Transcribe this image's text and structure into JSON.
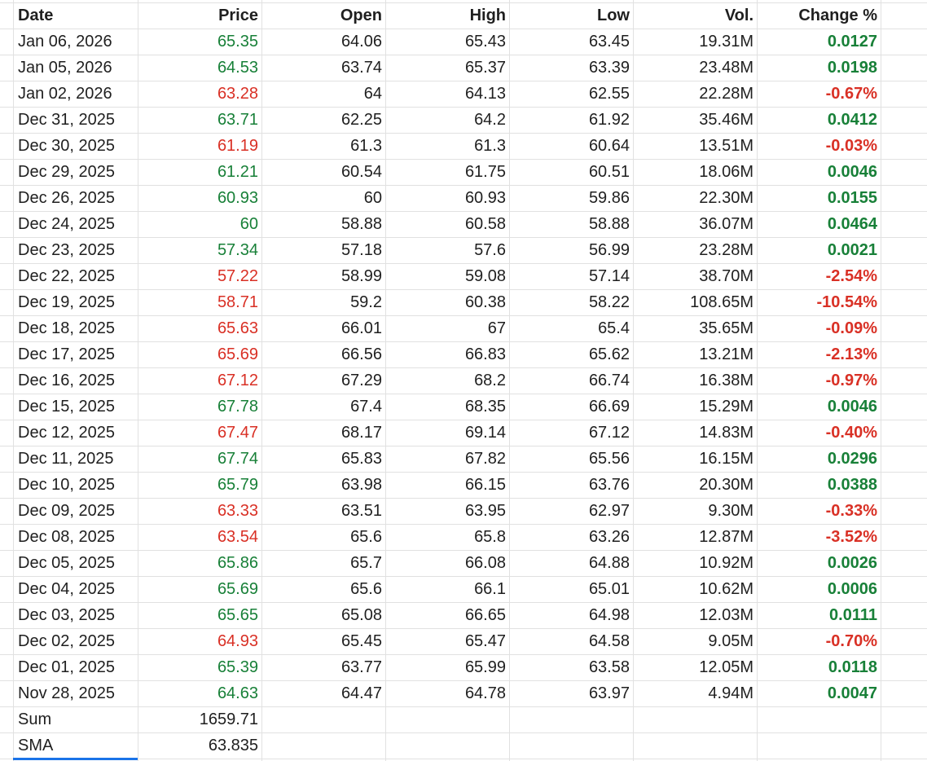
{
  "colors": {
    "up": "#188038",
    "down": "#d93025",
    "grid": "#e1e1e1",
    "text": "#1f1f1f",
    "selection": "#1a73e8"
  },
  "header": {
    "date": "Date",
    "price": "Price",
    "open": "Open",
    "high": "High",
    "low": "Low",
    "vol": "Vol.",
    "change": "Change %"
  },
  "rows": [
    {
      "date": "Jan 06, 2026",
      "price": "65.35",
      "open": "64.06",
      "high": "65.43",
      "low": "63.45",
      "vol": "19.31M",
      "change": "0.0127",
      "dir": "up"
    },
    {
      "date": "Jan 05, 2026",
      "price": "64.53",
      "open": "63.74",
      "high": "65.37",
      "low": "63.39",
      "vol": "23.48M",
      "change": "0.0198",
      "dir": "up"
    },
    {
      "date": "Jan 02, 2026",
      "price": "63.28",
      "open": "64",
      "high": "64.13",
      "low": "62.55",
      "vol": "22.28M",
      "change": "-0.67%",
      "dir": "down"
    },
    {
      "date": "Dec 31, 2025",
      "price": "63.71",
      "open": "62.25",
      "high": "64.2",
      "low": "61.92",
      "vol": "35.46M",
      "change": "0.0412",
      "dir": "up"
    },
    {
      "date": "Dec 30, 2025",
      "price": "61.19",
      "open": "61.3",
      "high": "61.3",
      "low": "60.64",
      "vol": "13.51M",
      "change": "-0.03%",
      "dir": "down"
    },
    {
      "date": "Dec 29, 2025",
      "price": "61.21",
      "open": "60.54",
      "high": "61.75",
      "low": "60.51",
      "vol": "18.06M",
      "change": "0.0046",
      "dir": "up"
    },
    {
      "date": "Dec 26, 2025",
      "price": "60.93",
      "open": "60",
      "high": "60.93",
      "low": "59.86",
      "vol": "22.30M",
      "change": "0.0155",
      "dir": "up"
    },
    {
      "date": "Dec 24, 2025",
      "price": "60",
      "open": "58.88",
      "high": "60.58",
      "low": "58.88",
      "vol": "36.07M",
      "change": "0.0464",
      "dir": "up"
    },
    {
      "date": "Dec 23, 2025",
      "price": "57.34",
      "open": "57.18",
      "high": "57.6",
      "low": "56.99",
      "vol": "23.28M",
      "change": "0.0021",
      "dir": "up"
    },
    {
      "date": "Dec 22, 2025",
      "price": "57.22",
      "open": "58.99",
      "high": "59.08",
      "low": "57.14",
      "vol": "38.70M",
      "change": "-2.54%",
      "dir": "down"
    },
    {
      "date": "Dec 19, 2025",
      "price": "58.71",
      "open": "59.2",
      "high": "60.38",
      "low": "58.22",
      "vol": "108.65M",
      "change": "-10.54%",
      "dir": "down"
    },
    {
      "date": "Dec 18, 2025",
      "price": "65.63",
      "open": "66.01",
      "high": "67",
      "low": "65.4",
      "vol": "35.65M",
      "change": "-0.09%",
      "dir": "down"
    },
    {
      "date": "Dec 17, 2025",
      "price": "65.69",
      "open": "66.56",
      "high": "66.83",
      "low": "65.62",
      "vol": "13.21M",
      "change": "-2.13%",
      "dir": "down"
    },
    {
      "date": "Dec 16, 2025",
      "price": "67.12",
      "open": "67.29",
      "high": "68.2",
      "low": "66.74",
      "vol": "16.38M",
      "change": "-0.97%",
      "dir": "down"
    },
    {
      "date": "Dec 15, 2025",
      "price": "67.78",
      "open": "67.4",
      "high": "68.35",
      "low": "66.69",
      "vol": "15.29M",
      "change": "0.0046",
      "dir": "up"
    },
    {
      "date": "Dec 12, 2025",
      "price": "67.47",
      "open": "68.17",
      "high": "69.14",
      "low": "67.12",
      "vol": "14.83M",
      "change": "-0.40%",
      "dir": "down"
    },
    {
      "date": "Dec 11, 2025",
      "price": "67.74",
      "open": "65.83",
      "high": "67.82",
      "low": "65.56",
      "vol": "16.15M",
      "change": "0.0296",
      "dir": "up"
    },
    {
      "date": "Dec 10, 2025",
      "price": "65.79",
      "open": "63.98",
      "high": "66.15",
      "low": "63.76",
      "vol": "20.30M",
      "change": "0.0388",
      "dir": "up"
    },
    {
      "date": "Dec 09, 2025",
      "price": "63.33",
      "open": "63.51",
      "high": "63.95",
      "low": "62.97",
      "vol": "9.30M",
      "change": "-0.33%",
      "dir": "down"
    },
    {
      "date": "Dec 08, 2025",
      "price": "63.54",
      "open": "65.6",
      "high": "65.8",
      "low": "63.26",
      "vol": "12.87M",
      "change": "-3.52%",
      "dir": "down"
    },
    {
      "date": "Dec 05, 2025",
      "price": "65.86",
      "open": "65.7",
      "high": "66.08",
      "low": "64.88",
      "vol": "10.92M",
      "change": "0.0026",
      "dir": "up"
    },
    {
      "date": "Dec 04, 2025",
      "price": "65.69",
      "open": "65.6",
      "high": "66.1",
      "low": "65.01",
      "vol": "10.62M",
      "change": "0.0006",
      "dir": "up"
    },
    {
      "date": "Dec 03, 2025",
      "price": "65.65",
      "open": "65.08",
      "high": "66.65",
      "low": "64.98",
      "vol": "12.03M",
      "change": "0.0111",
      "dir": "up"
    },
    {
      "date": "Dec 02, 2025",
      "price": "64.93",
      "open": "65.45",
      "high": "65.47",
      "low": "64.58",
      "vol": "9.05M",
      "change": "-0.70%",
      "dir": "down"
    },
    {
      "date": "Dec 01, 2025",
      "price": "65.39",
      "open": "63.77",
      "high": "65.99",
      "low": "63.58",
      "vol": "12.05M",
      "change": "0.0118",
      "dir": "up"
    },
    {
      "date": "Nov 28, 2025",
      "price": "64.63",
      "open": "64.47",
      "high": "64.78",
      "low": "63.97",
      "vol": "4.94M",
      "change": "0.0047",
      "dir": "up"
    }
  ],
  "summary": [
    {
      "label": "Sum",
      "value": "1659.71"
    },
    {
      "label": "SMA",
      "value": "63.835"
    }
  ]
}
